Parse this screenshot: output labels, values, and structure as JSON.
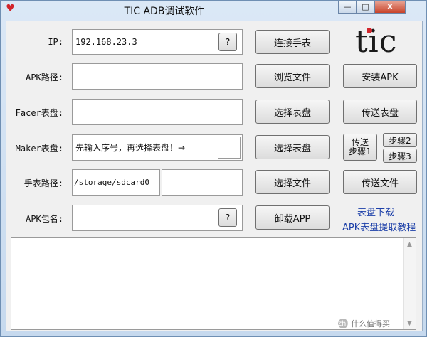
{
  "window": {
    "title": "TIC ADB调试软件",
    "app_icon": "heart-icon",
    "controls": {
      "minimize": "—",
      "maximize": "□",
      "close": "X"
    }
  },
  "labels": {
    "ip": "IP:",
    "apk_path": "APK路径:",
    "facer_dial": "Facer表盘:",
    "maker_dial": "Maker表盘:",
    "watch_path": "手表路径:",
    "apk_package": "APK包名:"
  },
  "fields": {
    "ip_value": "192.168.23.3",
    "apk_path_value": "",
    "facer_value": "",
    "maker_value": "先输入序号，再选择表盘！→",
    "maker_index_value": "",
    "watch_path_value": "/storage/sdcard0",
    "watch_path_extra": "",
    "apk_package_value": "",
    "log_text": ""
  },
  "buttons": {
    "ip_help": "?",
    "package_help": "?",
    "connect_watch": "连接手表",
    "browse_file": "浏览文件",
    "install_apk": "安装APK",
    "facer_select": "选择表盘",
    "facer_send": "传送表盘",
    "maker_select": "选择表盘",
    "maker_send": "传送\n步骤1",
    "step2": "步骤2",
    "step3": "步骤3",
    "select_file": "选择文件",
    "send_file": "传送文件",
    "uninstall_app": "卸载APP"
  },
  "links": {
    "dial_download": "表盘下载",
    "apk_tutorial": "APK表盘提取教程"
  },
  "logo": {
    "text": "tic"
  },
  "watermark": {
    "icon": "zhi",
    "text": "什么值得买"
  },
  "colors": {
    "link": "#1c3fa8",
    "logo_dot": "#d2252b"
  }
}
